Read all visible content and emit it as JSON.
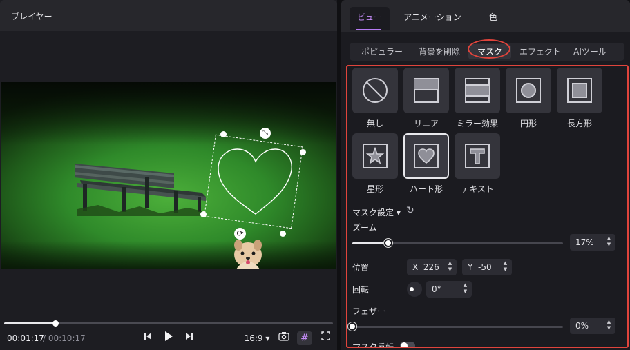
{
  "player": {
    "title": "プレイヤー",
    "current_time": "00:01:17",
    "total_time": "/ 00:10:17",
    "progress_fraction": 0.155,
    "aspect_ratio": "16:9",
    "icons": [
      "skip-back-icon",
      "play-icon",
      "skip-forward-icon",
      "camera-icon",
      "grid-icon",
      "fullscreen-icon",
      "scale-icon",
      "rotate-icon"
    ]
  },
  "panel": {
    "top_tabs": [
      "ビュー",
      "アニメーション",
      "色"
    ],
    "active_top_tab": "ビュー",
    "sub_tabs": [
      "ポピュラー",
      "背景を削除",
      "マスク",
      "エフェクト",
      "AIツール"
    ],
    "active_sub_tab": "マスク",
    "masks": [
      {
        "label": "無し",
        "icon": "none-icon"
      },
      {
        "label": "リニア",
        "icon": "linear-icon"
      },
      {
        "label": "ミラー効果",
        "icon": "mirror-icon"
      },
      {
        "label": "円形",
        "icon": "circle-icon"
      },
      {
        "label": "長方形",
        "icon": "rectangle-icon"
      },
      {
        "label": "星形",
        "icon": "star-icon"
      },
      {
        "label": "ハート形",
        "icon": "heart-icon"
      },
      {
        "label": "テキスト",
        "icon": "text-icon"
      }
    ],
    "selected_mask": "ハート形",
    "mask_settings_label": "マスク設定",
    "zoom": {
      "label": "ズーム",
      "value": "17%",
      "fraction": 0.17
    },
    "position": {
      "label": "位置",
      "x_label": "X",
      "x_value": "226",
      "y_label": "Y",
      "y_value": "-50"
    },
    "rotation": {
      "label": "回転",
      "value": "0°"
    },
    "feather": {
      "label": "フェザー",
      "value": "0%",
      "fraction": 0.0
    },
    "invert": {
      "label": "マスク反転",
      "on": false
    }
  },
  "colors": {
    "accent": "#b77cf5",
    "highlight": "#e0443c"
  }
}
